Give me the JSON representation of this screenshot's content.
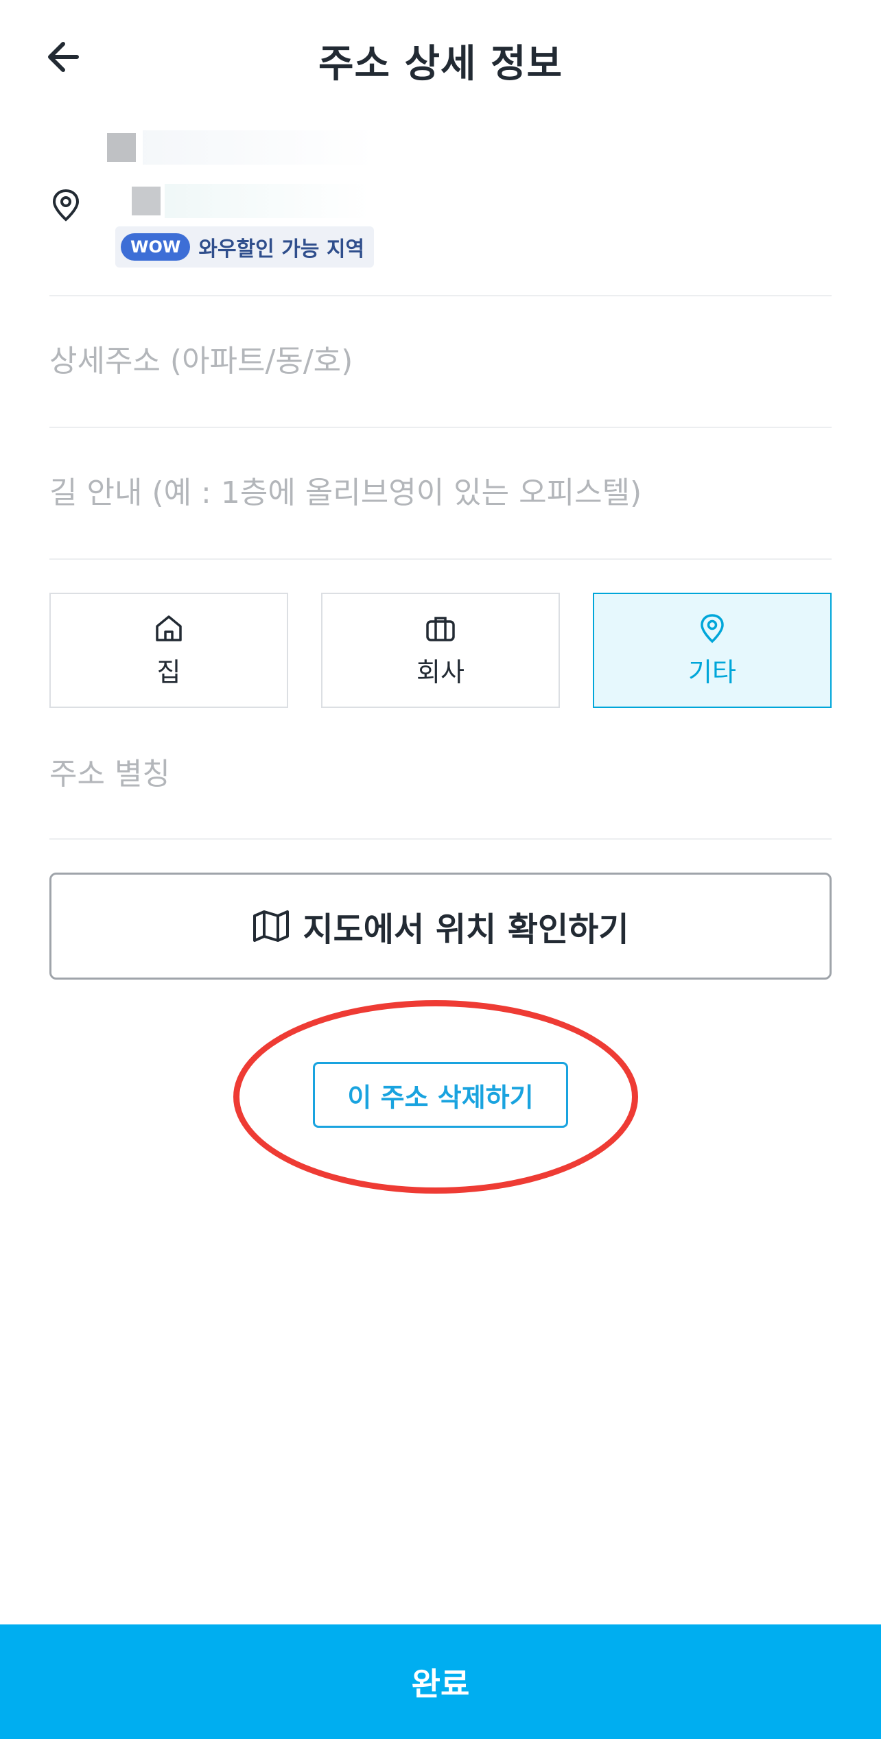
{
  "header": {
    "title": "주소 상세 정보",
    "back_icon": "arrow-left-icon"
  },
  "address": {
    "pin_icon": "location-pin-icon",
    "wow_badge": "WOW",
    "wow_text": "와우할인 가능 지역"
  },
  "form": {
    "detail_placeholder": "상세주소 (아파트/동/호)",
    "guide_placeholder": "길 안내 (예 : 1층에 올리브영이 있는 오피스텔)",
    "alias_placeholder": "주소 별칭"
  },
  "types": [
    {
      "label": "집",
      "icon": "home-icon",
      "selected": false
    },
    {
      "label": "회사",
      "icon": "briefcase-icon",
      "selected": false
    },
    {
      "label": "기타",
      "icon": "location-pin-icon",
      "selected": true
    }
  ],
  "map_button": {
    "label": "지도에서 위치 확인하기",
    "icon": "map-icon"
  },
  "delete_button": {
    "label": "이 주소 삭제하기"
  },
  "complete_button": {
    "label": "완료"
  },
  "colors": {
    "accent": "#00a6d9",
    "complete_bg": "#00aef0",
    "annotation": "#ee3b34",
    "wow_badge": "#3d6ed6"
  }
}
